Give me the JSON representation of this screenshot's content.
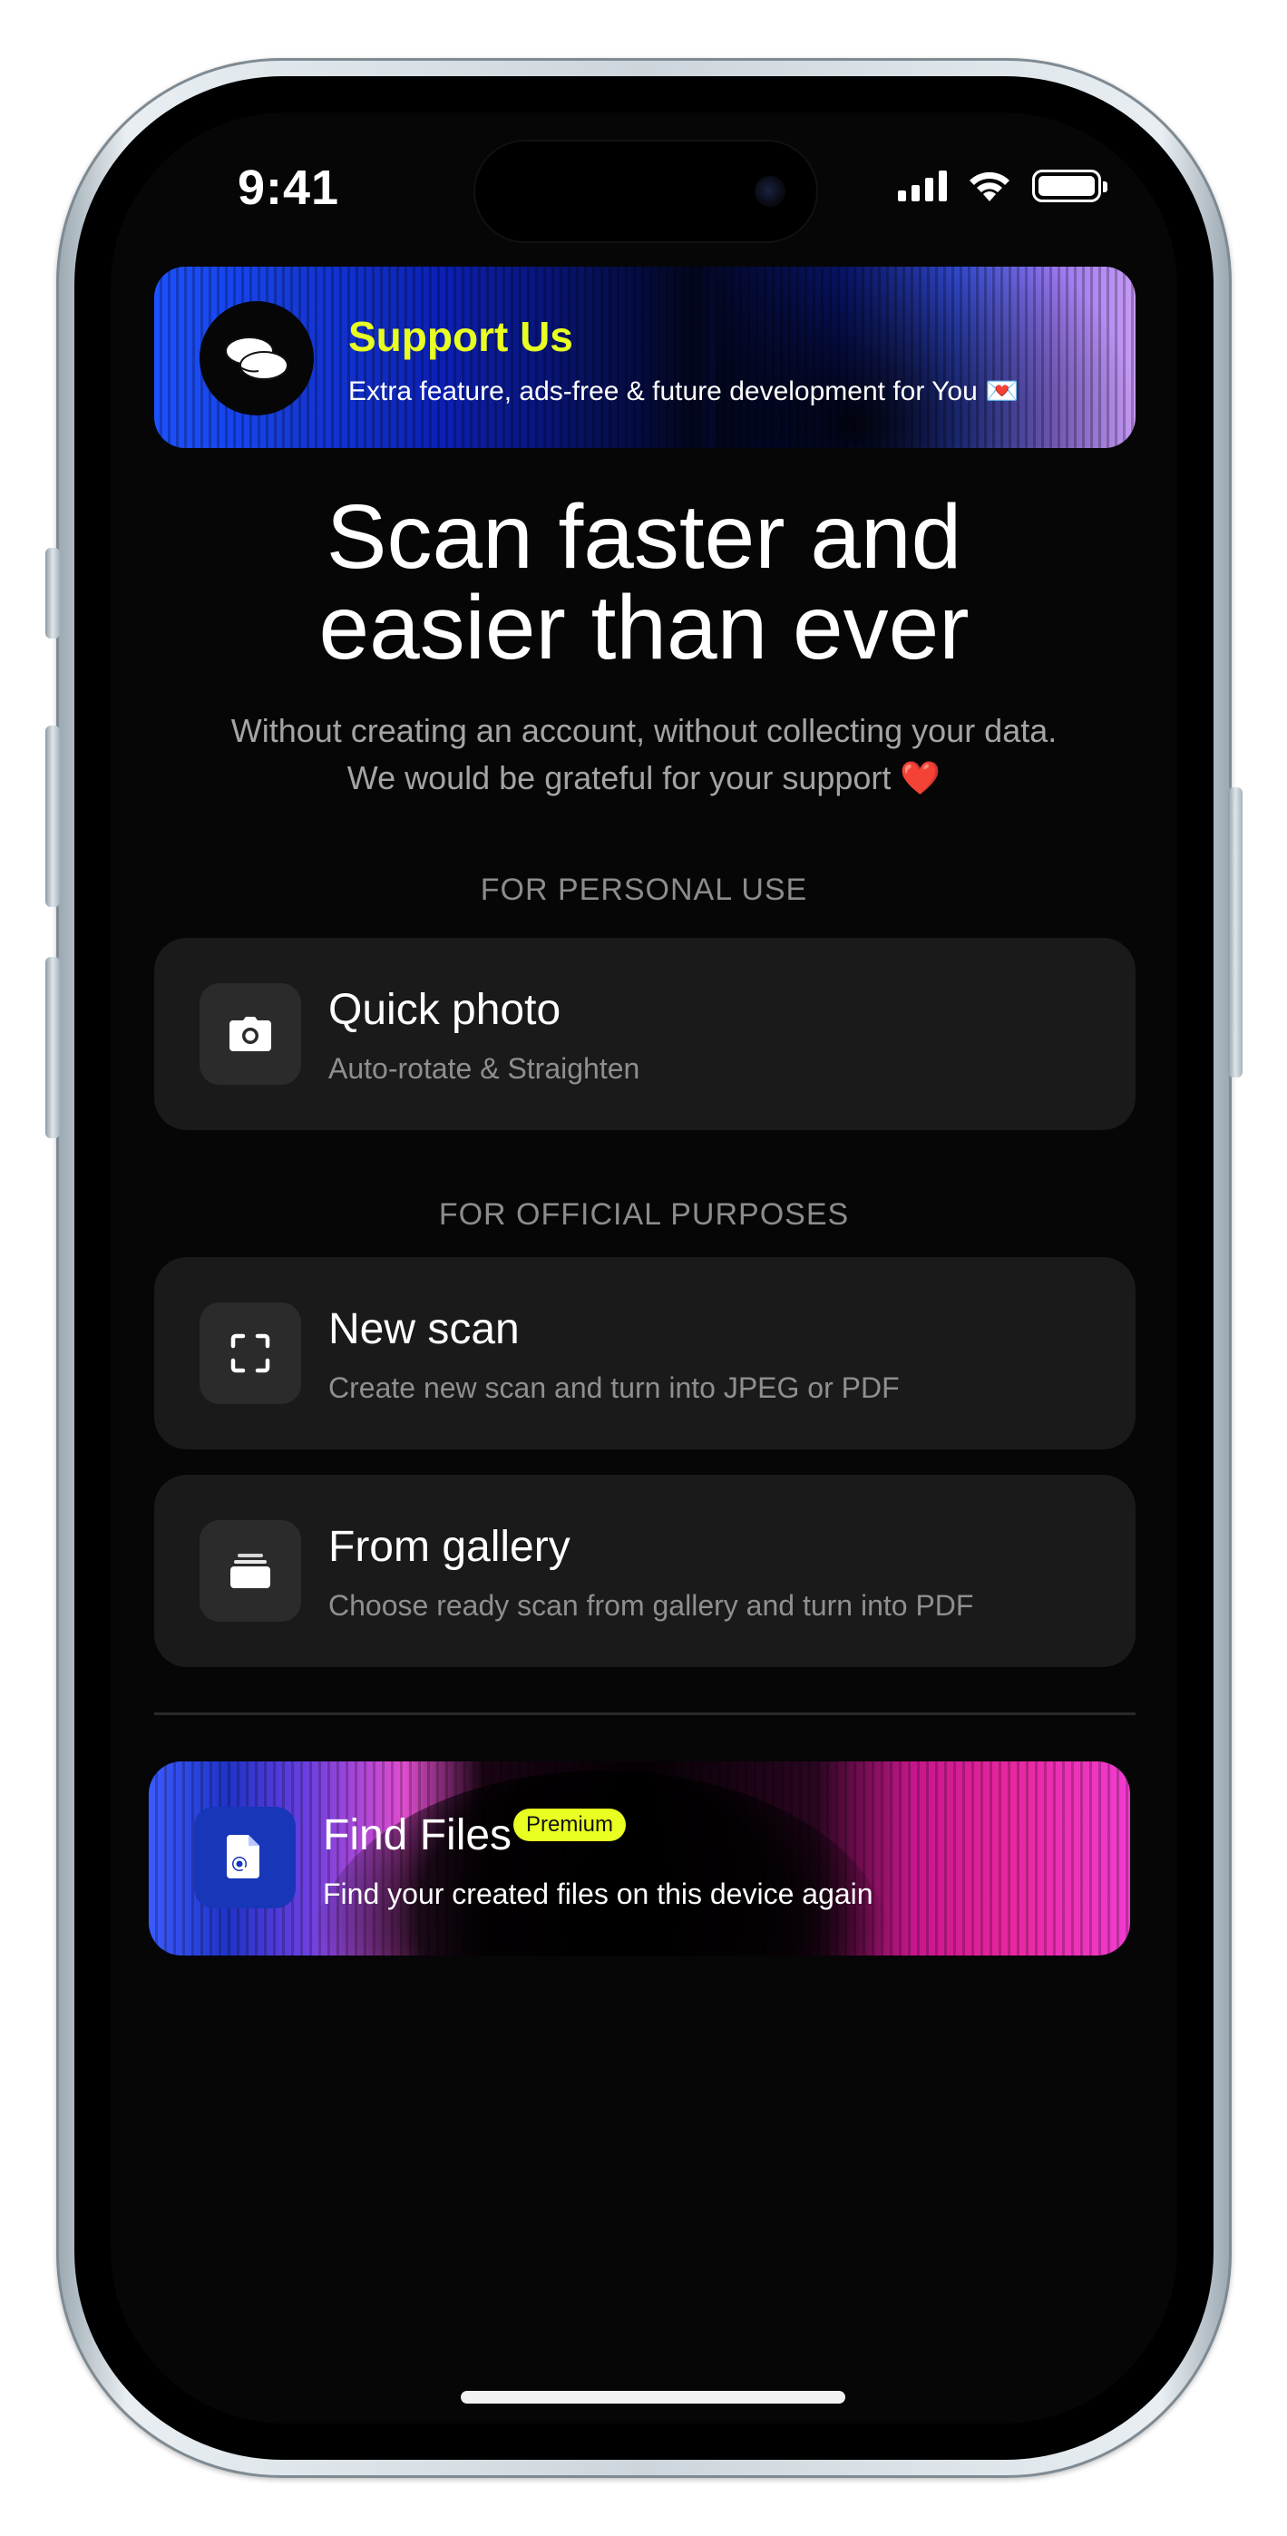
{
  "status_bar": {
    "time": "9:41"
  },
  "support_banner": {
    "title": "Support Us",
    "subtitle": "Extra feature, ads-free & future development for You 💌",
    "icon": "coins-icon"
  },
  "hero": {
    "title_line1": "Scan faster and",
    "title_line2": "easier than ever",
    "subtitle_line1": "Without creating an account, without collecting your data.",
    "subtitle_line2": "We would be grateful for your support ❤️"
  },
  "sections": {
    "personal_label": "FOR PERSONAL USE",
    "official_label": "FOR OFFICIAL PURPOSES"
  },
  "cards": {
    "quick_photo": {
      "title": "Quick photo",
      "subtitle": "Auto-rotate & Straighten",
      "icon": "camera-icon"
    },
    "new_scan": {
      "title": "New scan",
      "subtitle": "Create new scan and turn into JPEG or PDF",
      "icon": "scan-frame-icon"
    },
    "from_gallery": {
      "title": "From gallery",
      "subtitle": "Choose ready scan from gallery and turn into PDF",
      "icon": "gallery-stack-icon"
    }
  },
  "find_files": {
    "title": "Find Files",
    "badge": "Premium",
    "subtitle": "Find your created files on this device again",
    "icon": "file-search-icon"
  },
  "colors": {
    "accent_yellow": "#e8ff21",
    "card_bg": "#1a1a1a",
    "screen_bg": "#060606"
  }
}
